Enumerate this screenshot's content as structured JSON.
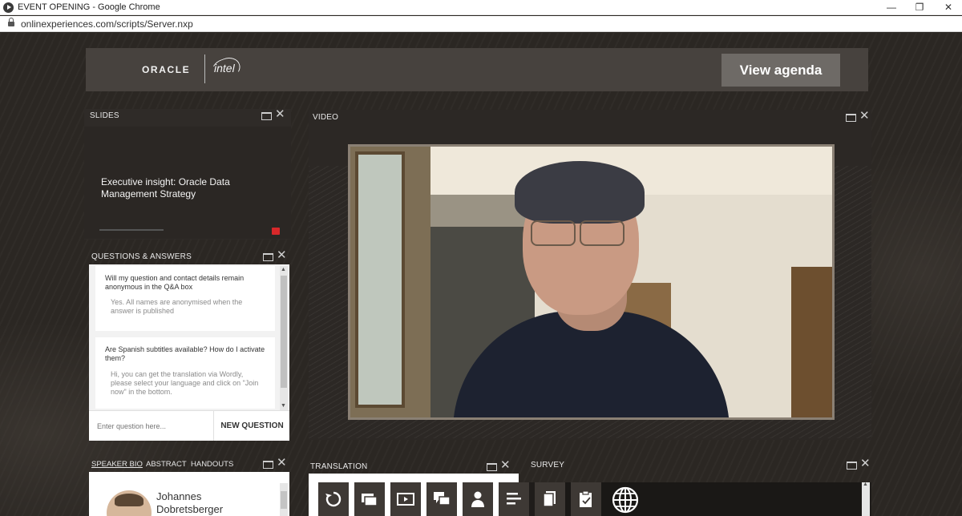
{
  "browser": {
    "window_title": "EVENT OPENING - Google Chrome",
    "url": "onlinexperiences.com/scripts/Server.nxp",
    "controls": {
      "minimize": "—",
      "restore": "❐",
      "close": "✕"
    }
  },
  "header": {
    "oracle_logo": "ORACLE",
    "intel_logo": "intel",
    "view_agenda_label": "View agenda"
  },
  "slides": {
    "title": "SLIDES",
    "heading": "Executive insight: Oracle Data Management Strategy"
  },
  "qa": {
    "title": "QUESTIONS & ANSWERS",
    "items": [
      {
        "question": "Will my question and contact details remain anonymous in the Q&A box",
        "answer": "Yes. All names are anonymised when the answer is published"
      },
      {
        "question": "Are Spanish subtitles available? How do I activate them?",
        "answer": "Hi, you can get the translation via Wordly, please select your language and click on \"Join now\" in the bottom."
      }
    ],
    "input_placeholder": "Enter question here...",
    "new_question_label": "NEW QUESTION"
  },
  "video": {
    "title": "VIDEO"
  },
  "speaker": {
    "tabs": [
      "SPEAKER BIO",
      "ABSTRACT",
      "HANDOUTS"
    ],
    "name_line1": "Johannes",
    "name_line2": "Dobretsberger"
  },
  "translation": {
    "title": "TRANSLATION"
  },
  "survey": {
    "title": "SURVEY"
  },
  "toolbar": {
    "icons": [
      "refresh-icon",
      "slides-icon",
      "video-icon",
      "qa-icon",
      "speaker-icon",
      "agenda-icon",
      "handouts-icon",
      "survey-icon",
      "globe-icon"
    ]
  },
  "colors": {
    "page_bg": "#2b2723",
    "header_bar": "#47423e",
    "agenda_button": "#6e6a66",
    "toolbar_button": "#3e3935",
    "slide_badge": "#d8282a"
  }
}
